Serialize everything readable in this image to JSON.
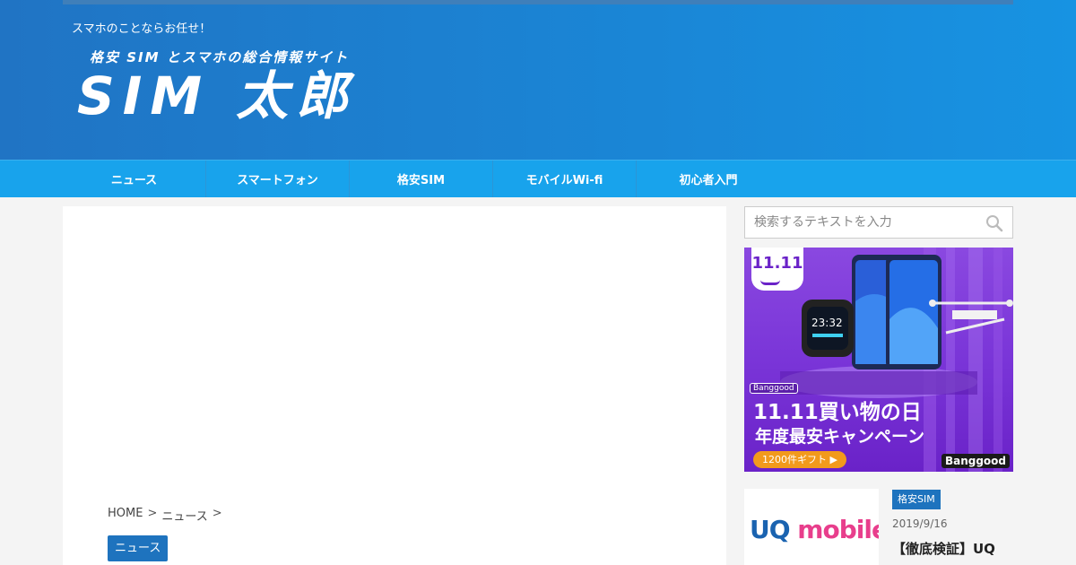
{
  "header": {
    "tagline": "スマホのことならお任せ！",
    "logo_sub": "格安 SIM とスマホの総合情報サイト",
    "logo_main": "SIM 太郎"
  },
  "nav": {
    "items": [
      {
        "label": "ニュース"
      },
      {
        "label": "スマートフォン"
      },
      {
        "label": "格安SIM"
      },
      {
        "label": "モバイルWi-fi"
      },
      {
        "label": "初心者入門"
      }
    ]
  },
  "breadcrumb": {
    "home": "HOME",
    "sep": ">",
    "news": "ニュース"
  },
  "article": {
    "category": "ニュース"
  },
  "sidebar": {
    "search": {
      "placeholder": "検索するテキストを入力"
    },
    "banner": {
      "badge": "11.11",
      "tag": "Banggood",
      "title": "11.11買い物の日",
      "subtitle": "年度最安キャンペーン",
      "button": "1200件ギフト ▶",
      "brand": "Banggood"
    },
    "post": {
      "thumb_logo_a": "UQ",
      "thumb_logo_b": "mobile",
      "category": "格安SIM",
      "date": "2019/9/16",
      "title": "【徹底検証】UQ"
    }
  },
  "colors": {
    "header": "#1a86d6",
    "nav": "#18a3ec",
    "accent": "#1e73be"
  }
}
